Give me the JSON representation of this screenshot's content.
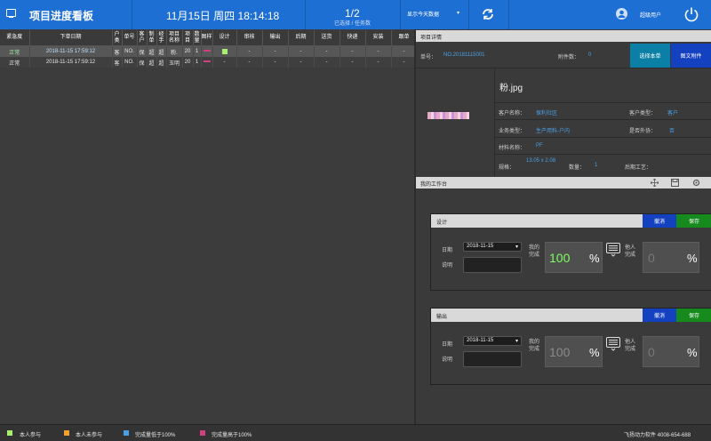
{
  "topbar": {
    "title": "项目进度看板",
    "date": "11月15日",
    "weekday": "周四",
    "time": "18:14:18",
    "counter": "1/2",
    "counter_sub": "已选择 / 任务数",
    "filter": "显示今天数据",
    "user": "超级用户",
    "brand_color": "#1e6fd3"
  },
  "table": {
    "headers": [
      "紧急度",
      "下单日期",
      "户类",
      "单号",
      "客户",
      "制单",
      "经手",
      "项目名称",
      "项目",
      "数量",
      "图样",
      "设计",
      "审核",
      "输出",
      "后期",
      "送货",
      "快递",
      "安装",
      "跟单"
    ],
    "rows": [
      [
        "正常",
        "2018-11-15 17:59:12",
        "客",
        "NO.",
        "保",
        "超",
        "超",
        "粉.",
        "20",
        "1",
        "",
        "",
        "-",
        "-",
        "-",
        "-",
        "-",
        "-",
        "-"
      ],
      [
        "正常",
        "2018-11-15 17:59:12",
        "客",
        "NO.",
        "保",
        "超",
        "超",
        "玉明",
        "20",
        "1",
        "",
        "-",
        "-",
        "-",
        "-",
        "-",
        "-",
        "-",
        "-"
      ]
    ]
  },
  "detail": {
    "title": "项目详情",
    "order_label": "单号：",
    "order_value": "NO.20181115001",
    "attach_label": "附件数：",
    "attach_value": "0",
    "btn_select": "选择本单",
    "btn_attach": "图文附件",
    "file_name": "粉.jpg",
    "customer_label": "客户名称：",
    "customer_value": "保利社区",
    "ctype_label": "客户类型：",
    "ctype_value": "客户",
    "btype_label": "业务类型：",
    "btype_value": "生产用料-户内",
    "outsource_label": "是否外协：",
    "outsource_value": "否",
    "material_label": "材料名称：",
    "material_value": "PF",
    "spec_label": "规格：",
    "spec_value": "13.05 x 2.08",
    "qty_label": "数量：",
    "qty_value": "1",
    "post_label": "后期工艺："
  },
  "workbench": {
    "title": "我的工作台",
    "cards": [
      {
        "name": "设计",
        "cancel": "撤消",
        "save": "保存",
        "date_label": "日期",
        "date_value": "2018-11-15",
        "desc_label": "说明",
        "my_label": "我的完成",
        "my_value": "100",
        "pct": "%",
        "other_label": "他人完成",
        "other_value": "0"
      },
      {
        "name": "输出",
        "cancel": "撤消",
        "save": "保存",
        "date_label": "日期",
        "date_value": "2018-11-15",
        "desc_label": "说明",
        "my_label": "我的完成",
        "my_value": "100",
        "pct": "%",
        "other_label": "他人完成",
        "other_value": "0"
      }
    ]
  },
  "legend": {
    "items": [
      {
        "label": "本人参与",
        "color": "#a8ef70"
      },
      {
        "label": "本人未参与",
        "color": "#f0a030"
      },
      {
        "label": "完成量低于100%",
        "color": "#4aa0e8"
      },
      {
        "label": "完成量高于100%",
        "color": "#d04080"
      }
    ],
    "company": "飞扬动力软件  4008-654-688"
  }
}
